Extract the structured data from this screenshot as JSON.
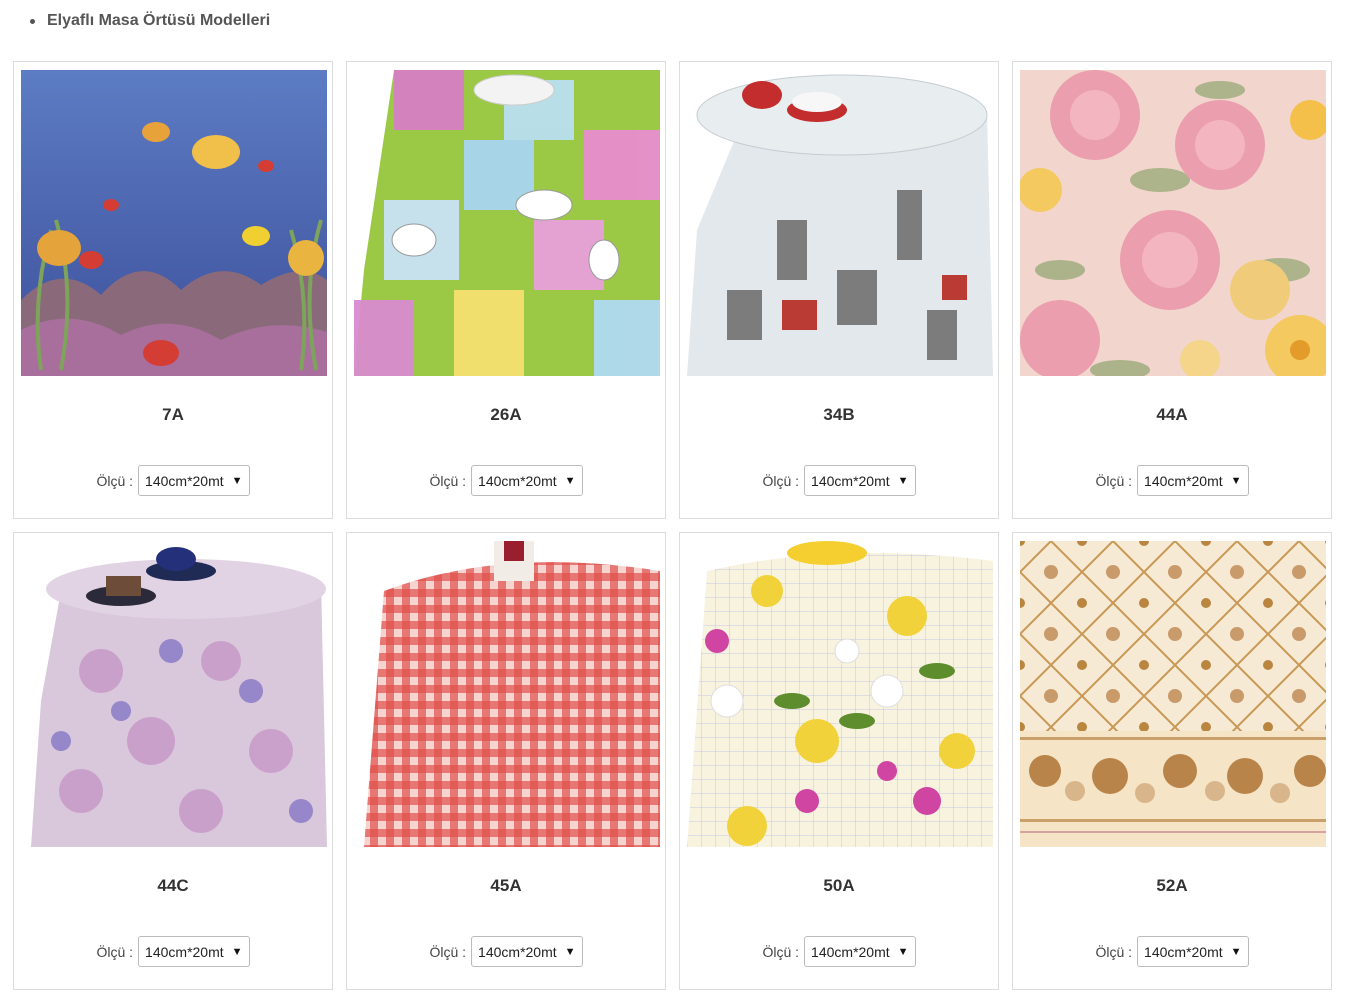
{
  "heading": {
    "bullet": "•",
    "title": "Elyaflı Masa Örtüsü Modelleri"
  },
  "size_label": "Ölçü :",
  "products": [
    {
      "code": "7A",
      "size": "140cm*20mt",
      "image": "underwater-fish-pattern"
    },
    {
      "code": "26A",
      "size": "140cm*20mt",
      "image": "teacup-patchwork-pattern"
    },
    {
      "code": "34B",
      "size": "140cm*20mt",
      "image": "istanbul-sketch-pattern"
    },
    {
      "code": "44A",
      "size": "140cm*20mt",
      "image": "pink-rose-daisy-pattern"
    },
    {
      "code": "44C",
      "size": "140cm*20mt",
      "image": "lilac-floral-pattern"
    },
    {
      "code": "45A",
      "size": "140cm*20mt",
      "image": "red-gingham-pattern"
    },
    {
      "code": "50A",
      "size": "140cm*20mt",
      "image": "sunflower-grid-pattern"
    },
    {
      "code": "52A",
      "size": "140cm*20mt",
      "image": "beige-trellis-rose-pattern"
    }
  ],
  "colors": {
    "card_border": "#dcdcdc",
    "heading": "#555555"
  }
}
